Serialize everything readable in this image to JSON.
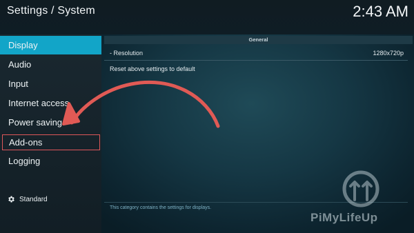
{
  "header": {
    "title": "Settings / System",
    "clock": "2:43 AM"
  },
  "sidebar": {
    "items": [
      {
        "label": "Display"
      },
      {
        "label": "Audio"
      },
      {
        "label": "Input"
      },
      {
        "label": "Internet access"
      },
      {
        "label": "Power saving"
      },
      {
        "label": "Add-ons"
      },
      {
        "label": "Logging"
      }
    ],
    "active_index": 0,
    "highlighted_index": 5,
    "level_label": "Standard"
  },
  "main": {
    "section_header": "General",
    "settings": [
      {
        "label": "- Resolution",
        "value": "1280x720p"
      },
      {
        "label": "Reset above settings to default",
        "value": ""
      }
    ],
    "help_text": "This category contains the settings for displays."
  },
  "watermark": {
    "text": "PiMyLifeUp"
  },
  "colors": {
    "accent": "#12a5c8",
    "highlight_box": "#e0585a",
    "arrow": "#e05a55"
  },
  "icons": {
    "level": "gear-icon",
    "annotation": "curved-arrow-icon",
    "logo": "pimylifeup-logo-icon"
  }
}
